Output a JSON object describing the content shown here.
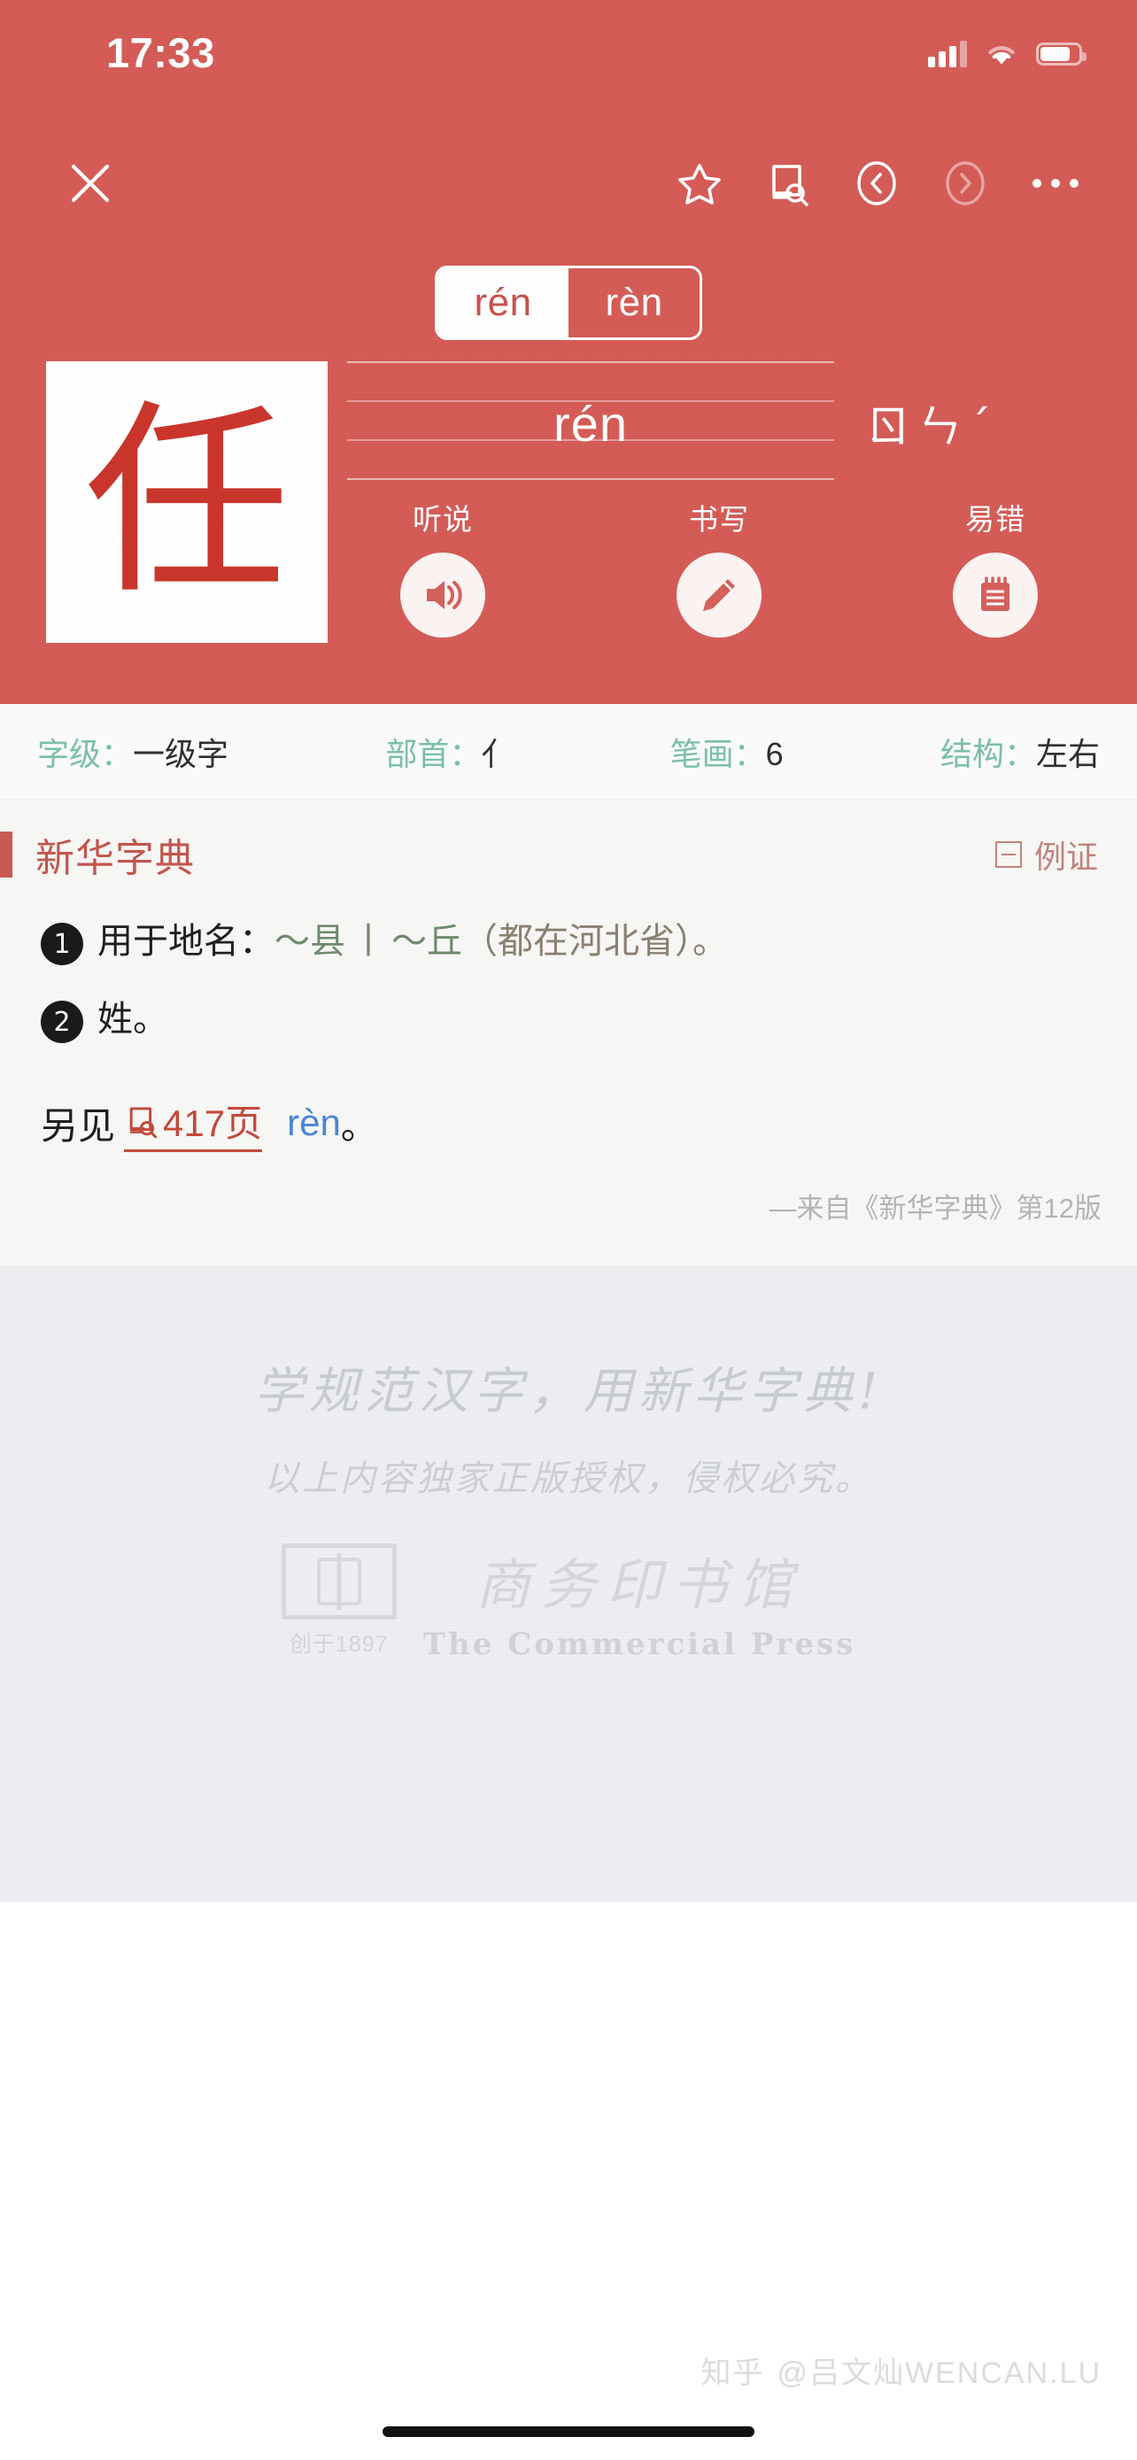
{
  "status_bar": {
    "time": "17:33",
    "cellular_icon": "cellular-signal-icon",
    "wifi_icon": "wifi-icon",
    "battery_icon": "battery-icon"
  },
  "toolbar": {
    "close_icon": "close-icon",
    "favorite_icon": "star-icon",
    "lookup_icon": "book-search-icon",
    "prev_icon": "chevron-left-circle-icon",
    "next_icon": "chevron-right-circle-icon",
    "more_icon": "more-dots-icon"
  },
  "pinyin_tabs": {
    "items": [
      {
        "label": "rén",
        "active": true
      },
      {
        "label": "rèn",
        "active": false
      }
    ]
  },
  "hero": {
    "character": "任",
    "pinyin": "rén",
    "zhuyin": "ㄖㄣˊ"
  },
  "actions": [
    {
      "label": "听说",
      "icon": "speaker-icon"
    },
    {
      "label": "书写",
      "icon": "pencil-icon"
    },
    {
      "label": "易错",
      "icon": "notepad-icon"
    }
  ],
  "info_bar": [
    {
      "key": "字级：",
      "value": "一级字"
    },
    {
      "key": "部首：",
      "value": "亻"
    },
    {
      "key": "笔画：",
      "value": "6"
    },
    {
      "key": "结构：",
      "value": "左右"
    }
  ],
  "section": {
    "title": "新华字典",
    "toggle_label": "例证",
    "toggle_icon": "collapse-box-icon"
  },
  "entries": [
    {
      "num": "❶",
      "lead": "用于地名：",
      "example1": "～县",
      "divider": "丨",
      "example2": "～丘",
      "note": "（都在河北省）。"
    },
    {
      "num": "❷",
      "lead": "姓。",
      "example1": "",
      "divider": "",
      "example2": "",
      "note": ""
    }
  ],
  "see_also": {
    "prefix": "另见",
    "page_icon": "book-search-icon",
    "page": "417页",
    "pinyin": "rèn",
    "suffix": "。"
  },
  "source": "—来自《新华字典》第12版",
  "footer": {
    "slogan": "学规范汉字，用新华字典!",
    "copyright": "以上内容独家正版授权，侵权必究。",
    "logo_icon": "book-logo-icon",
    "established": "创于1897",
    "publisher_cn": "商务印书馆",
    "publisher_en": "The Commercial Press"
  },
  "bottom": {
    "watermark_brand": "知乎",
    "watermark_user": "@吕文灿WENCAN.LU",
    "home_indicator": "home-indicator"
  },
  "colors": {
    "header_red": "#d45a55",
    "character_red": "#c9342a",
    "accent_red": "#c2564e",
    "info_key_teal": "#7bbfa8",
    "link_blue": "#4a86d8",
    "page_link_red": "#c24a3c"
  }
}
